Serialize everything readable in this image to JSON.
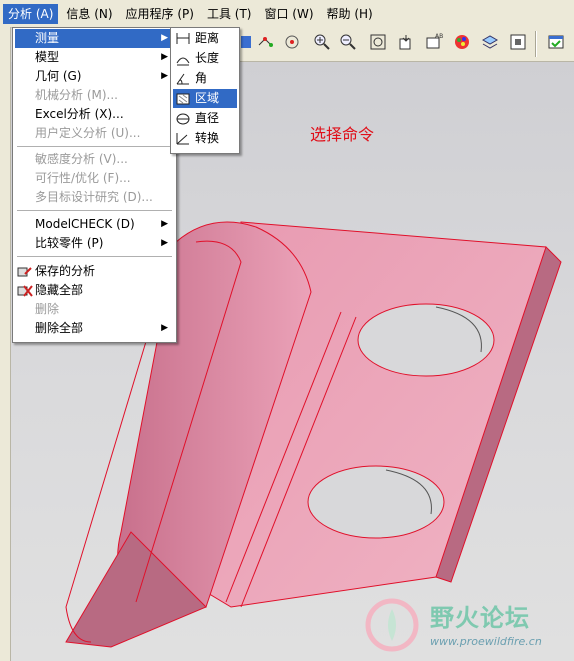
{
  "menubar": {
    "items": [
      {
        "label": "分析 (A)",
        "active": true
      },
      {
        "label": "信息 (N)",
        "active": false
      },
      {
        "label": "应用程序 (P)",
        "active": false
      },
      {
        "label": "工具 (T)",
        "active": false
      },
      {
        "label": "窗口 (W)",
        "active": false
      },
      {
        "label": "帮助 (H)",
        "active": false
      }
    ]
  },
  "analysis_menu": {
    "items": [
      {
        "label": "测量",
        "highlighted": true,
        "submenu": true
      },
      {
        "label": "模型",
        "submenu": true
      },
      {
        "label": "几何 (G)",
        "submenu": true
      },
      {
        "label": "机械分析 (M)...",
        "disabled": true
      },
      {
        "label": "Excel分析 (X)...",
        "disabled": false
      },
      {
        "label": "用户定义分析 (U)...",
        "disabled": true
      },
      {
        "label": "敏感度分析 (V)...",
        "disabled": true
      },
      {
        "label": "可行性/优化 (F)...",
        "disabled": true
      },
      {
        "label": "多目标设计研究 (D)...",
        "disabled": true
      },
      {
        "label": "ModelCHECK (D)",
        "submenu": true
      },
      {
        "label": "比较零件 (P)",
        "submenu": true
      },
      {
        "label": "保存的分析",
        "icon": "saved-analysis-icon"
      },
      {
        "label": "隐藏全部",
        "icon": "hide-all-icon"
      },
      {
        "label": "删除",
        "disabled": true
      },
      {
        "label": "删除全部",
        "submenu": true
      }
    ]
  },
  "measure_submenu": {
    "items": [
      {
        "label": "距离",
        "icon": "distance-icon"
      },
      {
        "label": "长度",
        "icon": "length-icon"
      },
      {
        "label": "角",
        "icon": "angle-icon"
      },
      {
        "label": "区域",
        "icon": "area-icon",
        "highlighted": true
      },
      {
        "label": "直径",
        "icon": "diameter-icon"
      },
      {
        "label": "转换",
        "icon": "transform-icon"
      }
    ]
  },
  "annotation": {
    "text": "选择命令",
    "color": "#e0101a"
  },
  "watermark": {
    "brand": "野火论坛",
    "url": "www.proewildfire.cn"
  },
  "colors": {
    "highlight": "#316ac5",
    "part_fill": "#e07a9c",
    "part_edge": "#e0102a"
  }
}
